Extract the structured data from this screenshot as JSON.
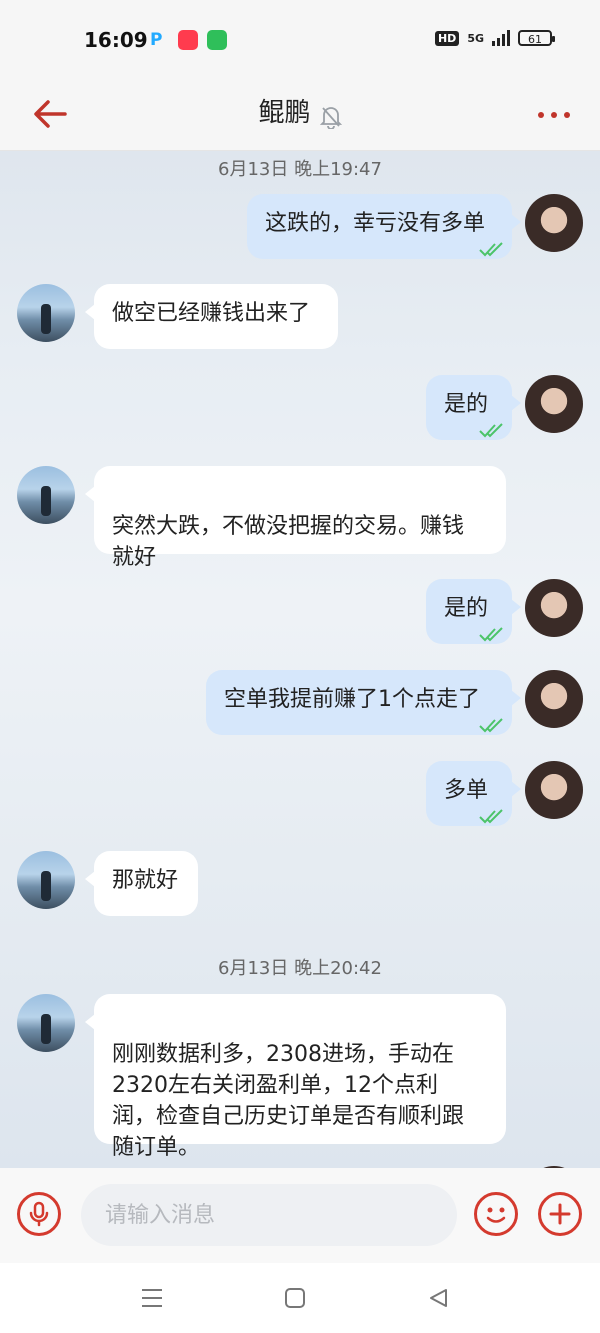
{
  "status_bar": {
    "time": "16:09",
    "hd_label": "HD",
    "network_label": "5G",
    "battery_level": "61",
    "app_icons": [
      "p-app-icon",
      "music-app-icon",
      "message-app-icon"
    ]
  },
  "header": {
    "title": "鲲鹏",
    "icons": [
      "back-arrow-icon",
      "bell-muted-icon",
      "more-dots-icon"
    ]
  },
  "chat": {
    "timestamps": [
      "6月13日 晚上19:47",
      "6月13日 晚上20:42"
    ],
    "messages": [
      {
        "side": "right",
        "text": "这跌的，幸亏没有多单",
        "read": true
      },
      {
        "side": "left",
        "text": "做空已经赚钱出来了"
      },
      {
        "side": "right",
        "text": "是的",
        "read": true
      },
      {
        "side": "left",
        "text": "突然大跌，不做没把握的交易。赚钱\n就好"
      },
      {
        "side": "right",
        "text": "是的",
        "read": true
      },
      {
        "side": "right",
        "text": "空单我提前赚了1个点走了",
        "read": true
      },
      {
        "side": "right",
        "text": "多单",
        "read": true
      },
      {
        "side": "left",
        "text": "那就好"
      },
      {
        "side": "left",
        "text": "刚刚数据利多，2308进场，手动在\n2320左右关闭盈利单，12个点利\n润，检查自己历史订单是否有顺利跟\n随订单。"
      }
    ]
  },
  "input_bar": {
    "placeholder": "请输入消息",
    "icons": [
      "microphone-icon",
      "emoji-icon",
      "plus-icon"
    ]
  },
  "nav_bar": {
    "icons": [
      "menu-icon",
      "home-square-icon",
      "back-triangle-icon"
    ]
  },
  "colors": {
    "accent": "#d43a2e",
    "bubble_sent": "#d6e7fb",
    "bubble_received": "#ffffff",
    "read_check": "#4cc46a"
  }
}
